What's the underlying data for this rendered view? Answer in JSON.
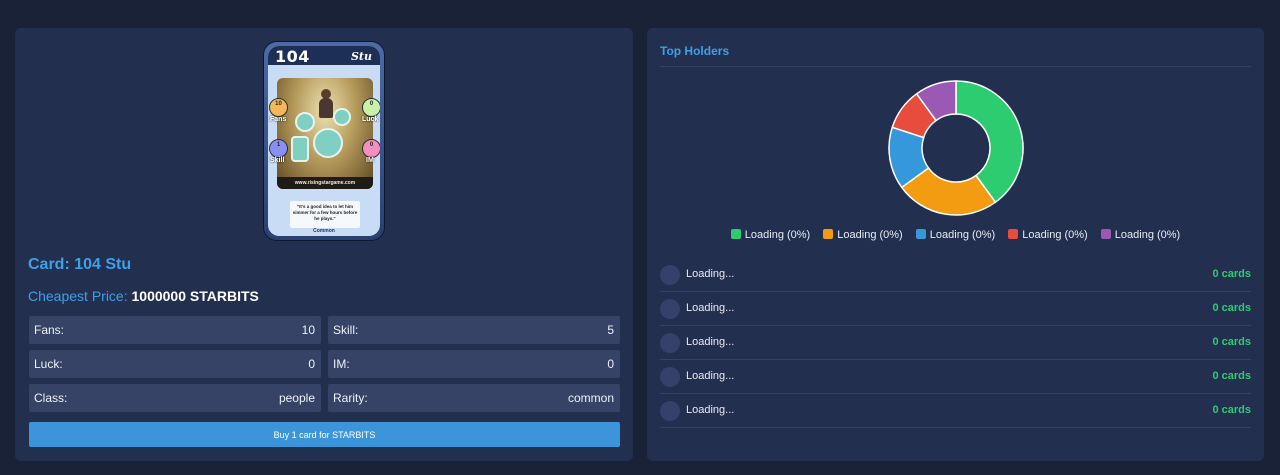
{
  "card": {
    "number": "104",
    "name": "Stu",
    "title": "Card: 104 Stu",
    "price_label": "Cheapest Price:",
    "price_value": "1000000 STARBITS",
    "image": {
      "stats": {
        "fans": "10",
        "luck": "0",
        "skill": "1",
        "im": "0"
      },
      "stat_labels": {
        "fans": "Fans",
        "luck": "Luck",
        "skill": "Skill",
        "im": "IM"
      },
      "website": "www.risingstargame.com",
      "quote": "\"It's a good idea to let him simmer for a few hours before he plays.\"",
      "rarity": "Common",
      "colors": {
        "fans": "#f6b75a",
        "luck": "#c8f2a8",
        "skill": "#8b8ff4",
        "im": "#f48fbd"
      }
    },
    "stats": [
      {
        "label": "Fans:",
        "value": "10"
      },
      {
        "label": "Skill:",
        "value": "5"
      },
      {
        "label": "Luck:",
        "value": "0"
      },
      {
        "label": "IM:",
        "value": "0"
      },
      {
        "label": "Class:",
        "value": "people"
      },
      {
        "label": "Rarity:",
        "value": "common"
      }
    ],
    "buy_button": "Buy 1 card for STARBITS"
  },
  "holders": {
    "title": "Top Holders",
    "legend": [
      {
        "label": "Loading (0%)",
        "color": "#2ecc71"
      },
      {
        "label": "Loading (0%)",
        "color": "#f39c12"
      },
      {
        "label": "Loading (0%)",
        "color": "#3498db"
      },
      {
        "label": "Loading (0%)",
        "color": "#e74c3c"
      },
      {
        "label": "Loading (0%)",
        "color": "#9b59b6"
      }
    ],
    "rows": [
      {
        "name": "Loading...",
        "count": "0 cards"
      },
      {
        "name": "Loading...",
        "count": "0 cards"
      },
      {
        "name": "Loading...",
        "count": "0 cards"
      },
      {
        "name": "Loading...",
        "count": "0 cards"
      },
      {
        "name": "Loading...",
        "count": "0 cards"
      }
    ]
  },
  "chart_data": {
    "type": "pie",
    "categories": [
      "Loading (0%)",
      "Loading (0%)",
      "Loading (0%)",
      "Loading (0%)",
      "Loading (0%)"
    ],
    "values": [
      40,
      25,
      15,
      10,
      10
    ],
    "colors": [
      "#2ecc71",
      "#f39c12",
      "#3498db",
      "#e74c3c",
      "#9b59b6"
    ],
    "legend": "bottom"
  }
}
